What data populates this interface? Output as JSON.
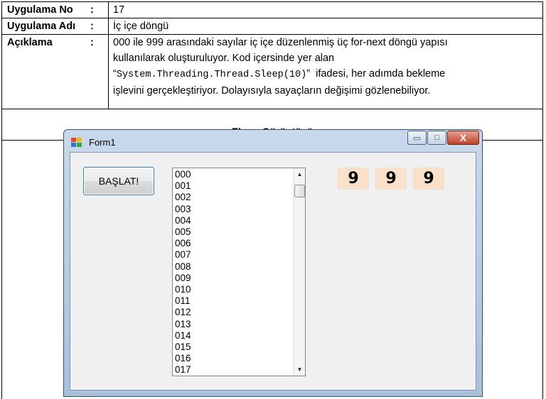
{
  "table": {
    "app_no_label": "Uygulama No",
    "app_no_value": "17",
    "app_name_label": "Uygulama Adı",
    "app_name_value": "İç içe döngü",
    "desc_label": "Açıklama",
    "colon": ":",
    "desc_line1": "000 ile 999 arasındaki sayılar iç içe düzenlenmiş üç for-next döngü yapısı",
    "desc_line2": "kullanılarak oluşturuluyor. Kod içersinde yer alan",
    "desc_quote_open": "“",
    "desc_code": "System.Threading.Thread.Sleep(10)",
    "desc_quote_close": "”",
    "desc_line3_rest": "ifadesi, her adımda bekleme",
    "desc_line4": "işlevini gerçekleştiriyor. Dolayısıyla sayaçların değişimi gözlenebiliyor.",
    "screenshot_title": "Ekran Görüntüsü"
  },
  "window": {
    "title": "Form1",
    "minimize_glyph": "▭",
    "maximize_glyph": "□",
    "close_glyph": "X",
    "start_button": "BAŞLAT!",
    "list_items": [
      "000",
      "001",
      "002",
      "003",
      "004",
      "005",
      "006",
      "007",
      "008",
      "009",
      "010",
      "011",
      "012",
      "013",
      "014",
      "015",
      "016",
      "017"
    ],
    "scroll_up_glyph": "▲",
    "scroll_down_glyph": "▼",
    "counters": [
      "9",
      "9",
      "9"
    ],
    "counter_bg": "#fde0c8"
  }
}
